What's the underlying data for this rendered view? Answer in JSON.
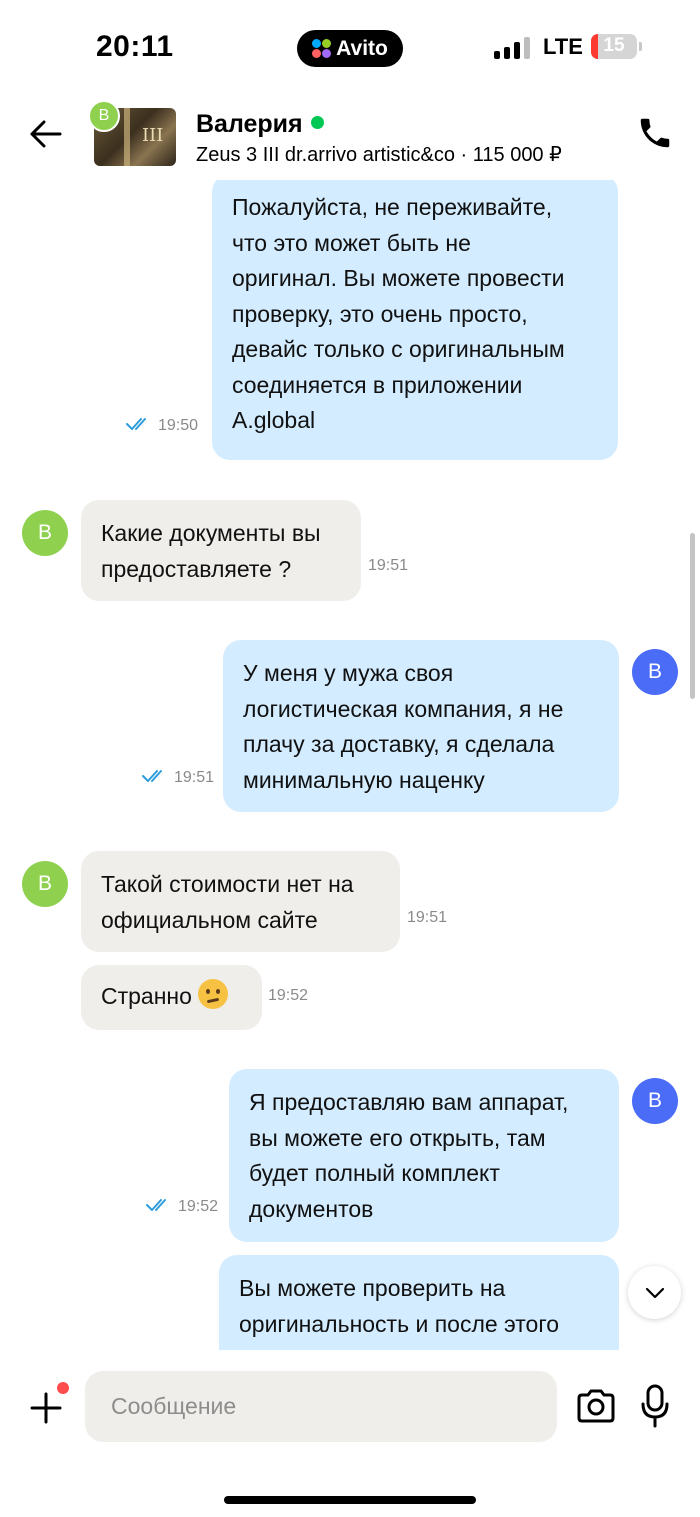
{
  "status_bar": {
    "time": "20:11",
    "app_pill": "Avito",
    "network": "LTE",
    "battery": "15",
    "battery_level": 0.15
  },
  "header": {
    "avatar_letter": "В",
    "contact_name": "Валерия",
    "online": true,
    "listing": "Zeus 3 III dr.arrivo artistic&co · 115 000 ₽"
  },
  "messages": [
    {
      "direction": "out",
      "lines": [
        "Пожалуйста, не переживайте,",
        "что это может быть не",
        "оригинал. Вы можете провести",
        "проверку, это очень просто,",
        "девайс только с оригинальным",
        "соединяется в приложении",
        "A.global"
      ],
      "time": "19:50",
      "read": true
    },
    {
      "direction": "in",
      "avatar": "В",
      "lines": [
        "Какие документы вы",
        "предоставляете ?"
      ],
      "time": "19:51"
    },
    {
      "direction": "out",
      "avatar": "В",
      "lines": [
        "У меня у мужа своя",
        "логистическая компания, я не",
        "плачу за доставку, я сделала",
        "минимальную наценку"
      ],
      "time": "19:51",
      "read": true
    },
    {
      "direction": "in",
      "avatar": "В",
      "lines": [
        "Такой стоимости нет на",
        "официальном сайте"
      ],
      "time": "19:51"
    },
    {
      "direction": "in",
      "lines": [
        "Странно"
      ],
      "emoji": "thinking-face",
      "time": "19:52"
    },
    {
      "direction": "out",
      "avatar": "В",
      "lines": [
        "Я предоставляю вам аппарат,",
        "вы можете его открыть, там",
        "будет полный комплект",
        "документов"
      ],
      "time": "19:52",
      "read": true
    },
    {
      "direction": "out",
      "lines": [
        "Вы можете проверить на",
        "оригинальность и после этого"
      ],
      "time": ""
    }
  ],
  "composer": {
    "placeholder": "Сообщение",
    "value": ""
  },
  "colors": {
    "out_bubble": "#d3ecff",
    "in_bubble": "#f0eeea",
    "avatar_in": "#8fd14f",
    "avatar_out": "#4a6cf7",
    "online": "#00c853",
    "read_check": "#2d9cdb"
  }
}
